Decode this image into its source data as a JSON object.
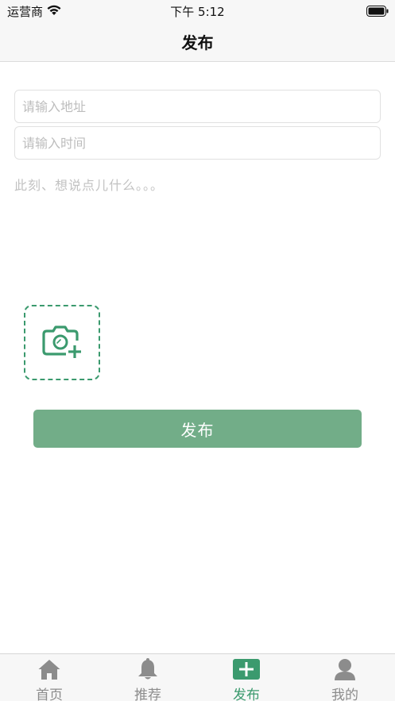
{
  "status_bar": {
    "carrier": "运营商",
    "time": "下午 5:12"
  },
  "nav": {
    "title": "发布"
  },
  "form": {
    "address_placeholder": "请输入地址",
    "address_value": "",
    "time_placeholder": "请输入时间",
    "time_value": "",
    "content_placeholder": "此刻、想说点儿什么。。。",
    "content_value": "",
    "photo_add_icon": "camera-plus-icon",
    "publish_label": "发布"
  },
  "colors": {
    "accent": "#3b9a6e",
    "button": "#72ad88",
    "tab_inactive": "#8c8c8c"
  },
  "tabs": [
    {
      "label": "首页",
      "icon": "home-icon",
      "active": false
    },
    {
      "label": "推荐",
      "icon": "bell-icon",
      "active": false
    },
    {
      "label": "发布",
      "icon": "plus-square-icon",
      "active": true
    },
    {
      "label": "我的",
      "icon": "user-icon",
      "active": false
    }
  ]
}
